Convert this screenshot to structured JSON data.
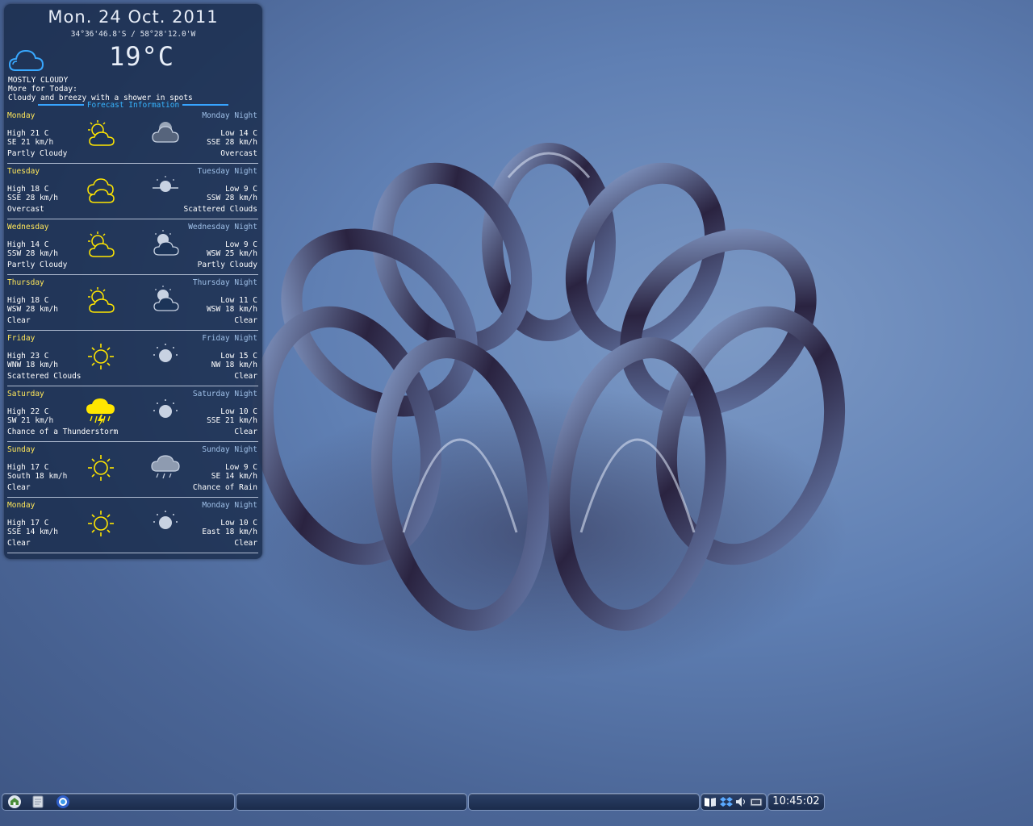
{
  "widget": {
    "date": "Mon. 24 Oct. 2011",
    "coordinates": "34°36'46.8'S / 58°28'12.0'W",
    "current_temp": "19°C",
    "condition": "MOSTLY CLOUDY",
    "more_label": "More for Today:",
    "summary": "Cloudy and breezy with a shower in spots",
    "forecast_header": "Forecast Information",
    "colors": {
      "day_label": "#ffe75a",
      "night_label": "#9fc0e8",
      "header": "#37b4ff",
      "sun_icon": "#ffe600"
    },
    "days": [
      {
        "day": "Monday",
        "night": "Monday Night",
        "high": "High 21 C",
        "day_wind": "SE 21 km/h",
        "day_cond": "Partly Cloudy",
        "day_icon": "partly-cloudy-icon",
        "low": "Low 14 C",
        "night_wind": "SSE  28 km/h",
        "night_cond": "Overcast",
        "night_icon": "night-overcast-icon"
      },
      {
        "day": "Tuesday",
        "night": "Tuesday Night",
        "high": "High 18 C",
        "day_wind": "SSE  28 km/h",
        "day_cond": "Overcast",
        "day_icon": "cloudy-icon",
        "low": "Low 9 C",
        "night_wind": "SSW 28 km/h",
        "night_cond": "Scattered Clouds",
        "night_icon": "night-scattered-clouds-icon"
      },
      {
        "day": "Wednesday",
        "night": "Wednesday Night",
        "high": "High 14 C",
        "day_wind": "SSW 28 km/h",
        "day_cond": "Partly Cloudy",
        "day_icon": "partly-cloudy-icon",
        "low": "Low 9 C",
        "night_wind": "WSW  25 km/h",
        "night_cond": "Partly Cloudy",
        "night_icon": "night-partly-cloudy-icon"
      },
      {
        "day": "Thursday",
        "night": "Thursday Night",
        "high": "High 18 C",
        "day_wind": "WSW 28 km/h",
        "day_cond": "Clear",
        "day_icon": "partly-cloudy-icon",
        "low": "Low 11 C",
        "night_wind": "WSW  18 km/h",
        "night_cond": "Clear",
        "night_icon": "night-partly-cloudy-icon"
      },
      {
        "day": "Friday",
        "night": "Friday Night",
        "high": "High 23 C",
        "day_wind": "WNW 18 km/h",
        "day_cond": "Scattered Clouds",
        "day_icon": "sun-icon",
        "low": "Low 15 C",
        "night_wind": "NW  18 km/h",
        "night_cond": "Clear",
        "night_icon": "moon-icon"
      },
      {
        "day": "Saturday",
        "night": "Saturday Night",
        "high": "High 22 C",
        "day_wind": "SW 21 km/h",
        "day_cond": "Chance of a Thunderstorm",
        "day_icon": "thunderstorm-icon",
        "low": "Low 10 C",
        "night_wind": "SSE  21 km/h",
        "night_cond": "Clear",
        "night_icon": "moon-icon"
      },
      {
        "day": "Sunday",
        "night": "Sunday Night",
        "high": "High 17 C",
        "day_wind": "South 18 km/h",
        "day_cond": "Clear",
        "day_icon": "sun-icon",
        "low": "Low 9 C",
        "night_wind": "SE  14 km/h",
        "night_cond": "Chance of Rain",
        "night_icon": "night-rain-icon"
      },
      {
        "day": "Monday",
        "night": "Monday Night",
        "high": "High 17 C",
        "day_wind": "SSE 14 km/h",
        "day_cond": "Clear",
        "day_icon": "sun-icon",
        "low": "Low 10 C",
        "night_wind": "East  18 km/h",
        "night_cond": "Clear",
        "night_icon": "moon-icon"
      }
    ]
  },
  "taskbar": {
    "launchers": [
      "home-folder-icon",
      "notes-icon",
      "browser-icon"
    ],
    "tray_icons": [
      "dictionary-icon",
      "dropbox-icon",
      "volume-icon",
      "network-icon"
    ],
    "clock": "10:45:02"
  }
}
